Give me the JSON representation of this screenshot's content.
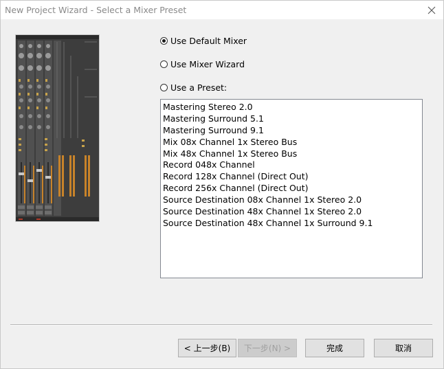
{
  "window": {
    "title": "New Project Wizard - Select a Mixer Preset",
    "close_icon": "close-icon"
  },
  "options": {
    "default_mixer": {
      "label": "Use Default Mixer",
      "checked": true
    },
    "mixer_wizard": {
      "label": "Use Mixer Wizard",
      "checked": false
    },
    "preset": {
      "label": "Use a Preset:",
      "checked": false
    }
  },
  "presets": [
    "Mastering Stereo 2.0",
    "Mastering Surround 5.1",
    "Mastering Surround 9.1",
    "Mix 08x Channel 1x Stereo Bus",
    "Mix 48x Channel 1x Stereo Bus",
    "Record 048x Channel",
    "Record 128x Channel (Direct Out)",
    "Record 256x Channel (Direct Out)",
    "Source Destination 08x Channel 1x Stereo 2.0",
    "Source Destination 48x Channel 1x Stereo 2.0",
    "Source Destination 48x Channel 1x Surround 9.1"
  ],
  "buttons": {
    "back": "< 上一步(B)",
    "next": "下一步(N) >",
    "finish": "完成",
    "cancel": "取消"
  },
  "colors": {
    "panel": "#f0f0f0",
    "mixer_body": "#3a3a3a",
    "meter": "#c8832a",
    "led": "#e0b830"
  }
}
